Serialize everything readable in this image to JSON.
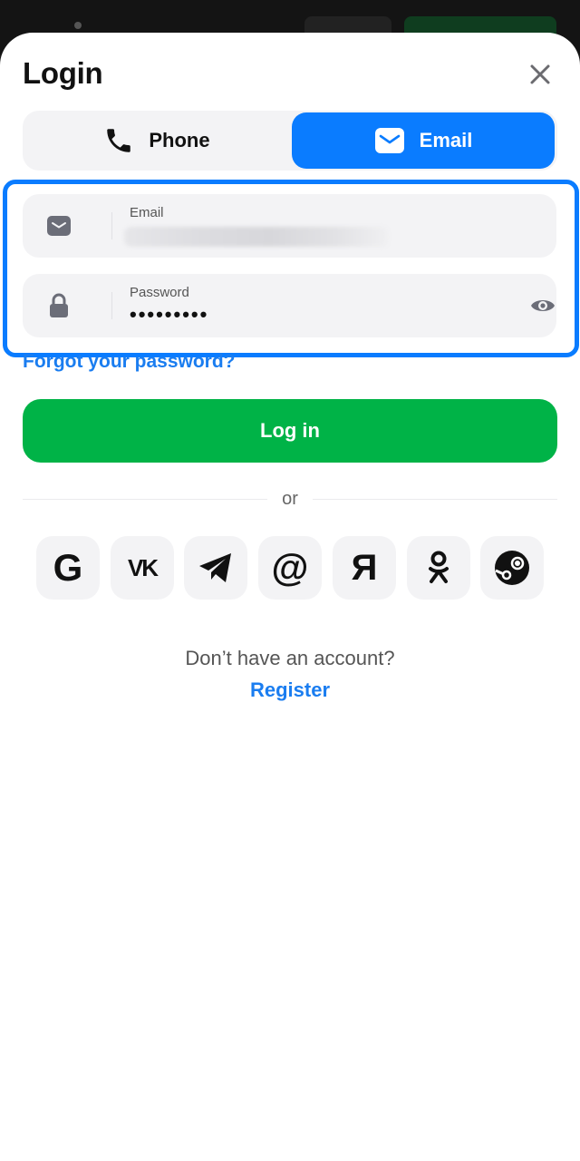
{
  "modal": {
    "title": "Login"
  },
  "tabs": {
    "phone_label": "Phone",
    "email_label": "Email",
    "active": "Email"
  },
  "fields": {
    "email": {
      "label": "Email",
      "value": ""
    },
    "password": {
      "label": "Password",
      "value": "•••••••••"
    }
  },
  "links": {
    "forgot_password": "Forgot your password?",
    "register": "Register"
  },
  "actions": {
    "login_label": "Log in"
  },
  "divider_text": "or",
  "social": [
    {
      "name": "google",
      "glyph": "G"
    },
    {
      "name": "vk",
      "glyph": "VK"
    },
    {
      "name": "telegram",
      "glyph": ""
    },
    {
      "name": "mail",
      "glyph": "@"
    },
    {
      "name": "yandex",
      "glyph": "Я"
    },
    {
      "name": "odnoklassniki",
      "glyph": ""
    },
    {
      "name": "steam",
      "glyph": ""
    }
  ],
  "signup_prompt": "Don’t have an account?",
  "colors": {
    "accent_blue": "#0a7cff",
    "link_blue": "#1a7df0",
    "primary_green": "#00b347"
  }
}
